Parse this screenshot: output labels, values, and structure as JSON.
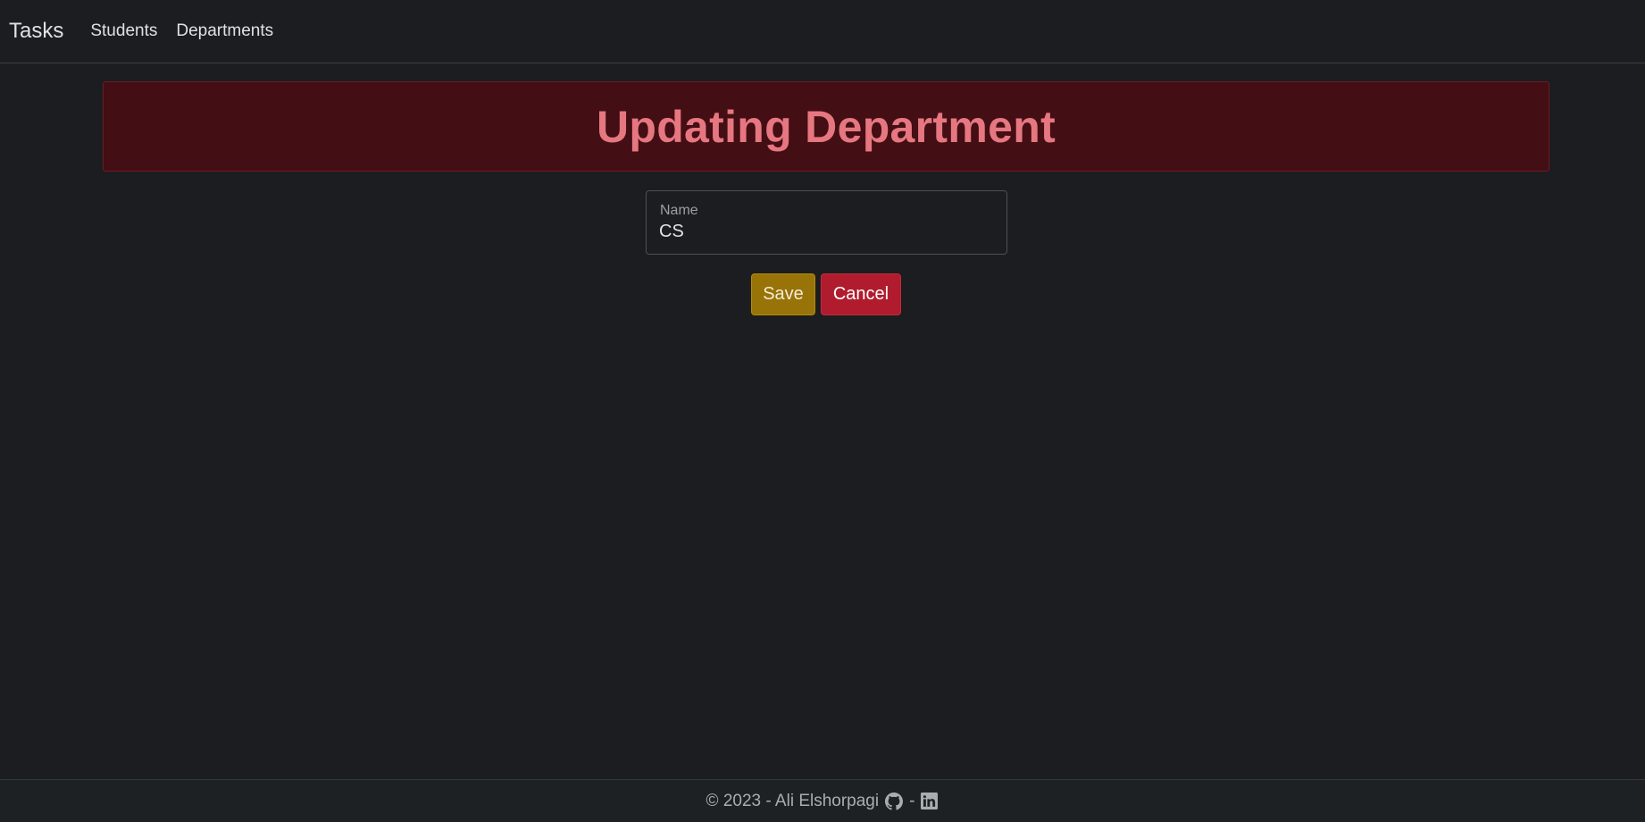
{
  "navbar": {
    "brand": "Tasks",
    "links": [
      "Students",
      "Departments"
    ]
  },
  "banner": {
    "title": "Updating Department"
  },
  "form": {
    "name_label": "Name",
    "name_value": "CS"
  },
  "buttons": {
    "save_label": "Save",
    "cancel_label": "Cancel"
  },
  "footer": {
    "copyright": "© 2023 - Ali Elshorpagi",
    "separator": "-",
    "icons": [
      "github-icon",
      "linkedin-icon"
    ]
  },
  "colors": {
    "banner_bg": "#430e14",
    "banner_text": "#e67780",
    "save_bg": "#987308",
    "cancel_bg": "#b01c2e"
  }
}
